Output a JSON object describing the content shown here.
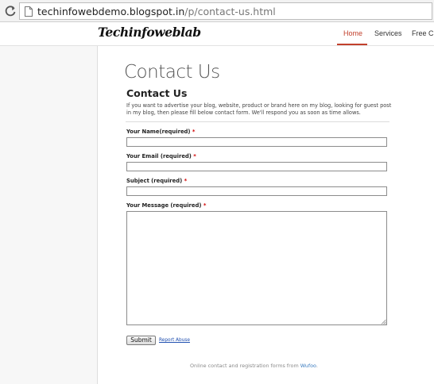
{
  "browser": {
    "url_host": "techinfowebdemo.blogspot.in",
    "url_path": "/p/contact-us.html"
  },
  "site": {
    "logo": "Techinfoweblab",
    "nav": [
      {
        "label": "Home",
        "active": true
      },
      {
        "label": "Services",
        "active": false
      },
      {
        "label": "Free C",
        "active": false
      }
    ],
    "accent_color": "#c2402c"
  },
  "page": {
    "title": "Contact Us"
  },
  "form": {
    "title": "Contact Us",
    "description": "If you want to advertise your blog, website, product or brand here on my blog, looking for guest post in my blog, then please fill below contact form. We'll respond you as soon as time allows.",
    "required_marker": "*",
    "fields": [
      {
        "label": "Your Name(required)",
        "value": ""
      },
      {
        "label": "Your Email (required)",
        "value": ""
      },
      {
        "label": "Subject (required)",
        "value": ""
      },
      {
        "label": "Your Message (required)",
        "value": ""
      }
    ],
    "submit_label": "Submit",
    "report_label": "Report Abuse"
  },
  "footer": {
    "text": "Online contact and registration forms from ",
    "brand": "Wufoo",
    "suffix": "."
  }
}
